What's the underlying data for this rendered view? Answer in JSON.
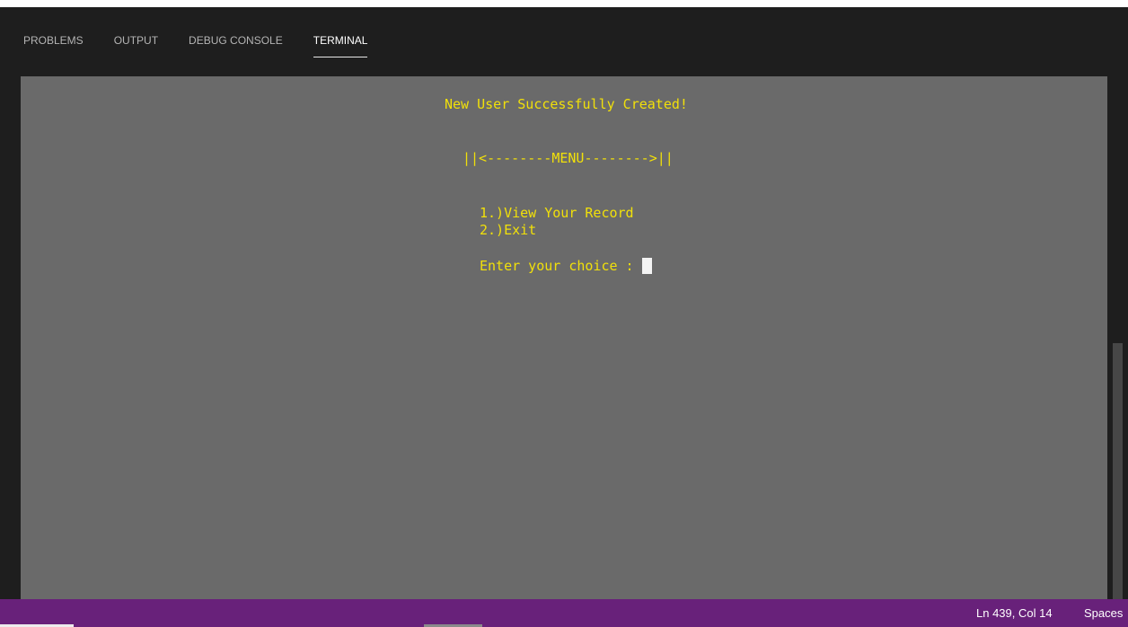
{
  "tabs": [
    {
      "label": "PROBLEMS"
    },
    {
      "label": "OUTPUT"
    },
    {
      "label": "DEBUG CONSOLE"
    },
    {
      "label": "TERMINAL",
      "active": true
    }
  ],
  "terminal": {
    "lines": [
      "New User Successfully Created!",
      "||<--------MENU-------->||",
      "1.)View Your Record",
      "2.)Exit",
      "Enter your choice : "
    ],
    "text_color": "#f1e00a",
    "background": "#6a6a6a"
  },
  "status": {
    "position": "Ln 439, Col 14",
    "indent": "Spaces",
    "background": "#68217a"
  }
}
